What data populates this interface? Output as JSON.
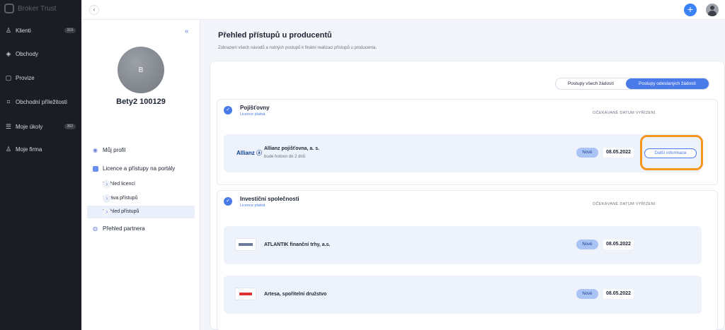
{
  "brand": {
    "name": "Broker Trust"
  },
  "nav": {
    "items": [
      {
        "label": "Klienti",
        "badge": "319"
      },
      {
        "label": "Obchody",
        "badge": ""
      },
      {
        "label": "Provize",
        "badge": ""
      },
      {
        "label": "Obchodní příležitosti",
        "badge": ""
      },
      {
        "label": "Moje úkoly",
        "badge": "352"
      },
      {
        "label": "Moje firma",
        "badge": ""
      }
    ]
  },
  "topbar": {
    "back_icon": "chevron-left-icon",
    "add_label": "+"
  },
  "profile": {
    "initial": "B",
    "name": "Bety2 100129",
    "menu": {
      "my_profile": "Můj profil",
      "licence": "Licence a přístupy na portály",
      "subs": [
        "Přehled licencí",
        "Správa přístupů",
        "Přehled přístupů"
      ],
      "partner": "Přehled partnera"
    }
  },
  "main": {
    "title": "Přehled přístupů u producentů",
    "subtitle": "Zobrazení všech návodů a nutných postupů k finální realizaci přístupů u producenta.",
    "toggle": {
      "option1": "Postupy všech žádostí",
      "option2": "Postupy odeslaných žádostí"
    },
    "sections": [
      {
        "title": "Pojišťovny",
        "subtitle": "Licence platná",
        "col_header": "OČEKÁVANÉ DATUM VYŘÍZENÍ",
        "rows": [
          {
            "logo": "Allianz ⓐ",
            "name": "Allianz pojišťovna, a. s.",
            "note": "bude hotovo do 2 dnů",
            "badge": "Nové",
            "date": "08.05.2022",
            "button": "Další informace"
          }
        ]
      },
      {
        "title": "Investiční společnosti",
        "subtitle": "Licence platná",
        "col_header": "OČEKÁVANÉ DATUM VYŘÍZENÍ",
        "rows": [
          {
            "logo": "",
            "name": "ATLANTIK finanční trhy, a.s.",
            "badge": "Nové",
            "date": "08.05.2022"
          },
          {
            "logo": "",
            "name": "Artesa, spořitelní družstvo",
            "badge": "Nové",
            "date": "08.05.2022"
          }
        ]
      }
    ]
  },
  "colors": {
    "nav_bg": "#1c1d24",
    "accent": "#4a7ae8",
    "highlight": "#f5961e"
  }
}
